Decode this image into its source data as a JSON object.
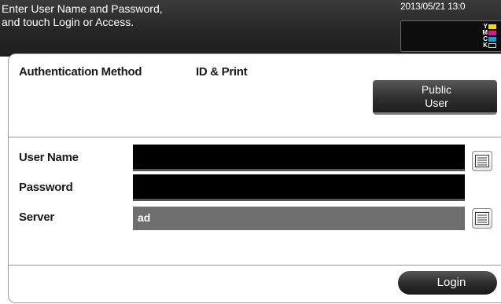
{
  "header": {
    "message": "Enter User Name and Password,\nand touch Login or Access.",
    "datetime": "2013/05/21 13:0"
  },
  "toner": [
    {
      "label": "Y",
      "color": "#f0dc00"
    },
    {
      "label": "M",
      "color": "#e0168a"
    },
    {
      "label": "C",
      "color": "#1a9bdc"
    },
    {
      "label": "K",
      "color": "#111111"
    }
  ],
  "auth": {
    "method_label": "Authentication Method",
    "method_value": "ID & Print",
    "public_user_label": "Public\nUser"
  },
  "form": {
    "user_name_label": "User Name",
    "user_name_value": "",
    "password_label": "Password",
    "password_value": "",
    "server_label": "Server",
    "server_value": "ad"
  },
  "actions": {
    "login_label": "Login"
  },
  "icons": {
    "keyboard": "keyboard-icon"
  }
}
